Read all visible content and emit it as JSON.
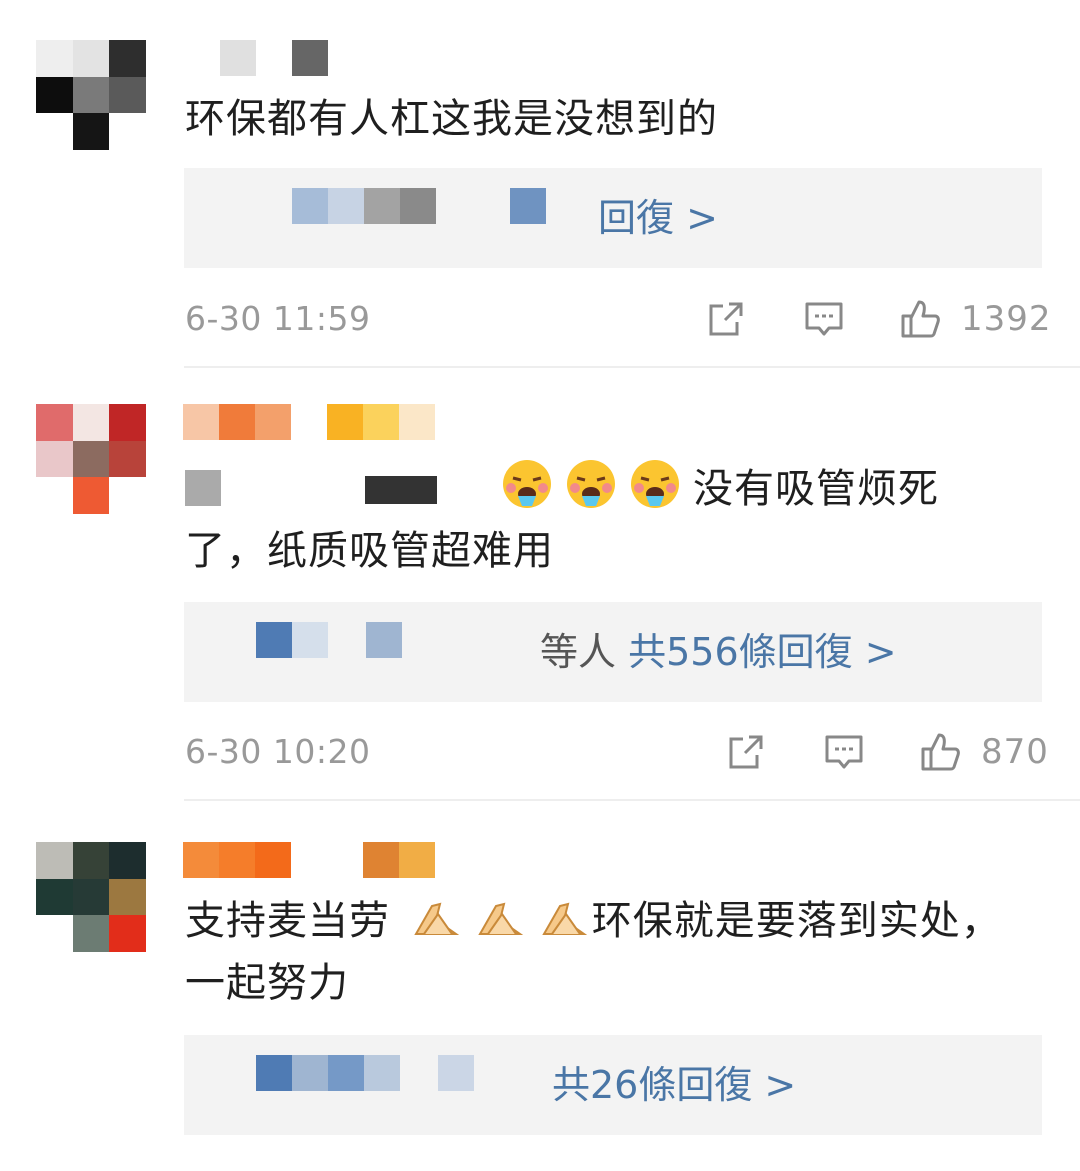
{
  "comments": [
    {
      "text_line1": "环保都有人杠这我是没想到的",
      "text_line2": "",
      "reply_summary": "回復 >",
      "reply_prefix": "",
      "time": "6-30 11:59",
      "likes": "1392",
      "avatar_colors": [
        "#eeeeee",
        "#e3e3e3",
        "#2e2e2e",
        "#0d0d0d",
        "#7a7a7a",
        "#5a5a5a",
        "#ffffff",
        "#151515",
        "#ffffff"
      ]
    },
    {
      "text_line1": "没有吸管烦死",
      "text_line2": "了，纸质吸管超难用",
      "reply_prefix": "等人",
      "reply_summary": "共556條回復 >",
      "time": "6-30 10:20",
      "likes": "870",
      "avatar_colors": [
        "#e06b6b",
        "#f3e6e3",
        "#c02626",
        "#e9c7c9",
        "#8c6b60",
        "#b8433a",
        "#ffffff",
        "#ee5a33",
        "#ffffff"
      ]
    },
    {
      "text_line1": "支持麦当劳",
      "text_line1b": "环保就是要落到实处，",
      "text_line2": "一起努力",
      "reply_prefix": "",
      "reply_summary": "共26條回復 >",
      "time": "",
      "likes": "",
      "avatar_colors": [
        "#bdbcb6",
        "#364237",
        "#1d2d2e",
        "#1f3a34",
        "#263a36",
        "#9c7840",
        "#ffffff",
        "#6c7c73",
        "#e22d1a"
      ]
    }
  ],
  "icons": [
    "share-icon",
    "comment-icon",
    "like-icon",
    "tired-face-emoji",
    "pray-hands-emoji"
  ]
}
